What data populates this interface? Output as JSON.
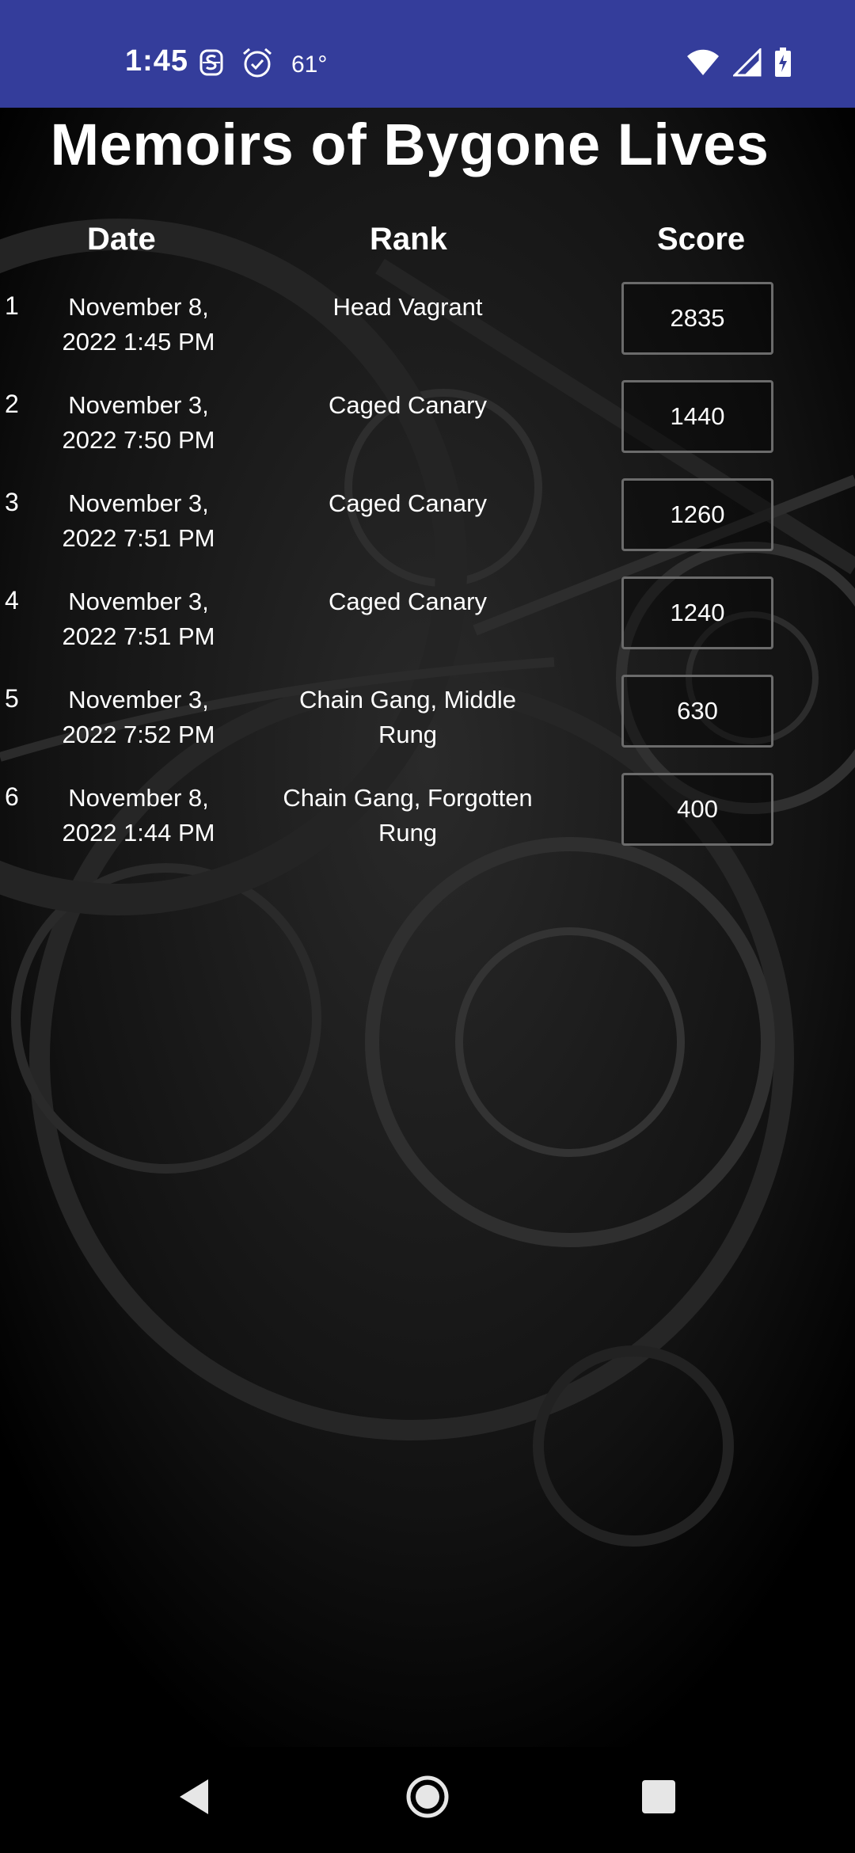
{
  "status_bar": {
    "time": "1:45",
    "temperature": "61°",
    "icons": [
      "notification-s-icon",
      "alarm-icon",
      "wifi-icon",
      "signal-icon",
      "battery-charging-icon"
    ]
  },
  "title": "Memoirs of Bygone Lives",
  "table": {
    "headers": {
      "date": "Date",
      "rank": "Rank",
      "score": "Score"
    },
    "rows": [
      {
        "index": "1",
        "date_line1": "November 8,",
        "date_line2": "2022 1:45 PM",
        "rank_line1": "Head Vagrant",
        "rank_line2": "",
        "score": "2835"
      },
      {
        "index": "2",
        "date_line1": "November 3,",
        "date_line2": "2022 7:50 PM",
        "rank_line1": "Caged Canary",
        "rank_line2": "",
        "score": "1440"
      },
      {
        "index": "3",
        "date_line1": "November 3,",
        "date_line2": "2022 7:51 PM",
        "rank_line1": "Caged Canary",
        "rank_line2": "",
        "score": "1260"
      },
      {
        "index": "4",
        "date_line1": "November 3,",
        "date_line2": "2022 7:51 PM",
        "rank_line1": "Caged Canary",
        "rank_line2": "",
        "score": "1240"
      },
      {
        "index": "5",
        "date_line1": "November 3,",
        "date_line2": "2022 7:52 PM",
        "rank_line1": "Chain Gang, Middle",
        "rank_line2": "Rung",
        "score": "630"
      },
      {
        "index": "6",
        "date_line1": "November 8,",
        "date_line2": "2022 1:44 PM",
        "rank_line1": "Chain Gang, Forgotten",
        "rank_line2": "Rung",
        "score": "400"
      }
    ]
  },
  "nav_bar": {
    "icons": [
      "back-icon",
      "home-icon",
      "recents-icon"
    ]
  },
  "colors": {
    "status_bar": "#343d9b",
    "background": "#000000",
    "text": "#ffffff",
    "score_border": "#6b6b6b"
  }
}
